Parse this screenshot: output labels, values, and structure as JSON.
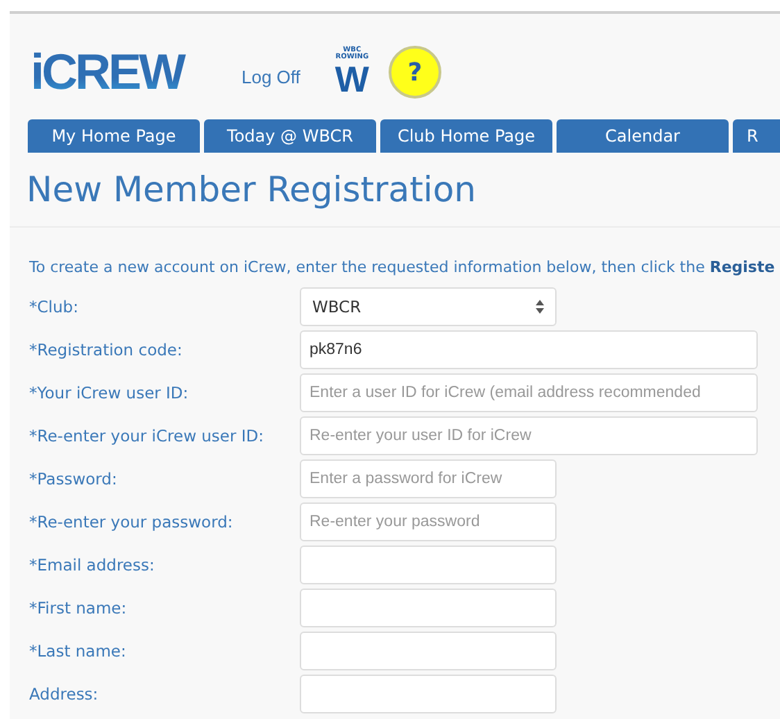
{
  "header": {
    "logo": "iCREW",
    "log_off": "Log Off",
    "crest": {
      "line_1": "WBC",
      "line_2": "ROWING",
      "letter": "W"
    },
    "help": "?"
  },
  "nav": {
    "tabs": [
      {
        "label": "My Home Page"
      },
      {
        "label": "Today @ WBCR"
      },
      {
        "label": "Club Home Page"
      },
      {
        "label": "Calendar"
      },
      {
        "label": "R"
      }
    ]
  },
  "title": "New Member Registration",
  "intro": "To create a new account on iCrew, enter the requested information below, then click the **Registe**",
  "fields": [
    {
      "label": "*Club:",
      "kind": "select",
      "value": "WBCR"
    },
    {
      "label": "*Registration code:",
      "kind": "wide",
      "value": "pk87n6"
    },
    {
      "label": "*Your iCrew user ID:",
      "kind": "wide",
      "placeholder": "Enter a user ID for iCrew (email address recommended"
    },
    {
      "label": "*Re-enter your iCrew user ID:",
      "kind": "wide",
      "placeholder": "Re-enter your user ID for iCrew"
    },
    {
      "label": "*Password:",
      "kind": "text",
      "placeholder": "Enter a password for iCrew"
    },
    {
      "label": "*Re-enter your password:",
      "kind": "text",
      "placeholder": "Re-enter your password"
    },
    {
      "label": "*Email address:",
      "kind": "text"
    },
    {
      "label": "*First name:",
      "kind": "text"
    },
    {
      "label": "*Last name:",
      "kind": "text"
    },
    {
      "label": "Address:",
      "kind": "text"
    }
  ]
}
